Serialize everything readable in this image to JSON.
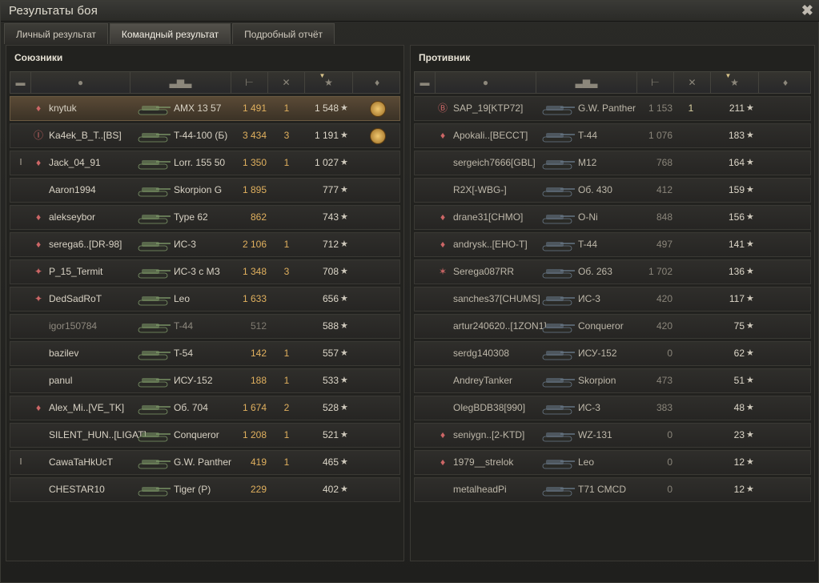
{
  "window": {
    "title": "Результаты боя",
    "close_glyph": "✖"
  },
  "tabs": [
    {
      "label": "Личный результат",
      "active": false
    },
    {
      "label": "Командный результат",
      "active": true
    },
    {
      "label": "Подробный отчёт",
      "active": false
    }
  ],
  "columns": {
    "squad_icon": "squad-icon",
    "player_icon": "player-icon",
    "tank_icon": "tank-icon",
    "damage_icon": "damage-icon",
    "kills_icon": "kills-icon",
    "xp_icon": "star-icon",
    "medal_icon": "medal-icon",
    "sort_indicator": "▼"
  },
  "allies": {
    "title": "Союзники",
    "rows": [
      {
        "squad": "",
        "clan": "♦",
        "name": "knytuk",
        "tank": "AMX 13 57",
        "damage": "1 491",
        "kills": "1",
        "xp": "1 548",
        "medal": true,
        "highlight": true,
        "dead": false
      },
      {
        "squad": "",
        "clan": "Ⓘ",
        "name": "Ka4ek_B_T..[BS]",
        "tank": "T-44-100 (Б)",
        "damage": "3 434",
        "kills": "3",
        "xp": "1 191",
        "medal": true,
        "highlight": false,
        "dead": false
      },
      {
        "squad": "Ⅰ",
        "clan": "♦",
        "name": "Jack_04_91",
        "tank": "Lorr. 155 50",
        "damage": "1 350",
        "kills": "1",
        "xp": "1 027",
        "medal": false,
        "highlight": false,
        "dead": false
      },
      {
        "squad": "",
        "clan": "",
        "name": "Aaron1994",
        "tank": "Skorpion G",
        "damage": "1 895",
        "kills": "",
        "xp": "777",
        "medal": false,
        "highlight": false,
        "dead": false
      },
      {
        "squad": "",
        "clan": "♦",
        "name": "alekseybor",
        "tank": "Type 62",
        "damage": "862",
        "kills": "",
        "xp": "743",
        "medal": false,
        "highlight": false,
        "dead": false
      },
      {
        "squad": "",
        "clan": "♦",
        "name": "serega6..[DR-98]",
        "tank": "ИС-3",
        "damage": "2 106",
        "kills": "1",
        "xp": "712",
        "medal": false,
        "highlight": false,
        "dead": false
      },
      {
        "squad": "",
        "clan": "✦",
        "name": "P_15_Termit",
        "tank": "ИС-3 с МЗ",
        "damage": "1 348",
        "kills": "3",
        "xp": "708",
        "medal": false,
        "highlight": false,
        "dead": false
      },
      {
        "squad": "",
        "clan": "✦",
        "name": "DedSadRoT",
        "tank": "Leo",
        "damage": "1 633",
        "kills": "",
        "xp": "656",
        "medal": false,
        "highlight": false,
        "dead": false
      },
      {
        "squad": "",
        "clan": "",
        "name": "igor150784",
        "tank": "T-44",
        "damage": "512",
        "kills": "",
        "xp": "588",
        "medal": false,
        "highlight": false,
        "dead": true
      },
      {
        "squad": "",
        "clan": "",
        "name": "bazilev",
        "tank": "T-54",
        "damage": "142",
        "kills": "1",
        "xp": "557",
        "medal": false,
        "highlight": false,
        "dead": false
      },
      {
        "squad": "",
        "clan": "",
        "name": "panul",
        "tank": "ИСУ-152",
        "damage": "188",
        "kills": "1",
        "xp": "533",
        "medal": false,
        "highlight": false,
        "dead": false
      },
      {
        "squad": "",
        "clan": "♦",
        "name": "Alex_Mi..[VE_TK]",
        "tank": "Об. 704",
        "damage": "1 674",
        "kills": "2",
        "xp": "528",
        "medal": false,
        "highlight": false,
        "dead": false
      },
      {
        "squad": "",
        "clan": "",
        "name": "SILENT_HUN..[LIGAT]",
        "tank": "Conqueror",
        "damage": "1 208",
        "kills": "1",
        "xp": "521",
        "medal": false,
        "highlight": false,
        "dead": false
      },
      {
        "squad": "Ⅰ",
        "clan": "",
        "name": "CawaTaHkUcT",
        "tank": "G.W. Panther",
        "damage": "419",
        "kills": "1",
        "xp": "465",
        "medal": false,
        "highlight": false,
        "dead": false
      },
      {
        "squad": "",
        "clan": "",
        "name": "CHESTAR10",
        "tank": "Tiger (P)",
        "damage": "229",
        "kills": "",
        "xp": "402",
        "medal": false,
        "highlight": false,
        "dead": false
      }
    ]
  },
  "enemies": {
    "title": "Противник",
    "rows": [
      {
        "clan": "Ⓑ",
        "name": "SAP_19[KTP72]",
        "tank": "G.W. Panther",
        "damage": "1 153",
        "kills": "1",
        "xp": "211"
      },
      {
        "clan": "♦",
        "name": "Apokali..[BECCT]",
        "tank": "T-44",
        "damage": "1 076",
        "kills": "",
        "xp": "183"
      },
      {
        "clan": "",
        "name": "sergeich7666[GBL]",
        "tank": "M12",
        "damage": "768",
        "kills": "",
        "xp": "164"
      },
      {
        "clan": "",
        "name": "R2X[-WBG-]",
        "tank": "Об. 430",
        "damage": "412",
        "kills": "",
        "xp": "159"
      },
      {
        "clan": "♦",
        "name": "drane31[CHMO]",
        "tank": "O-Ni",
        "damage": "848",
        "kills": "",
        "xp": "156"
      },
      {
        "clan": "♦",
        "name": "andrysk..[EHO-T]",
        "tank": "T-44",
        "damage": "497",
        "kills": "",
        "xp": "141"
      },
      {
        "clan": "✶",
        "name": "Serega087RR",
        "tank": "Об. 263",
        "damage": "1 702",
        "kills": "",
        "xp": "136"
      },
      {
        "clan": "",
        "name": "sanches37[CHUMS]",
        "tank": "ИС-3",
        "damage": "420",
        "kills": "",
        "xp": "117"
      },
      {
        "clan": "",
        "name": "artur240620..[1ZON1]",
        "tank": "Conqueror",
        "damage": "420",
        "kills": "",
        "xp": "75"
      },
      {
        "clan": "",
        "name": "serdg140308",
        "tank": "ИСУ-152",
        "damage": "0",
        "kills": "",
        "xp": "62"
      },
      {
        "clan": "",
        "name": "AndreyTanker",
        "tank": "Skorpion",
        "damage": "473",
        "kills": "",
        "xp": "51"
      },
      {
        "clan": "",
        "name": "OlegBDB38[990]",
        "tank": "ИС-3",
        "damage": "383",
        "kills": "",
        "xp": "48"
      },
      {
        "clan": "♦",
        "name": "seniygn..[2-KTD]",
        "tank": "WZ-131",
        "damage": "0",
        "kills": "",
        "xp": "23"
      },
      {
        "clan": "♦",
        "name": "1979__strelok",
        "tank": "Leo",
        "damage": "0",
        "kills": "",
        "xp": "12"
      },
      {
        "clan": "",
        "name": "metalheadPi",
        "tank": "T71 CMCD",
        "damage": "0",
        "kills": "",
        "xp": "12"
      }
    ]
  },
  "star_glyph": "★"
}
